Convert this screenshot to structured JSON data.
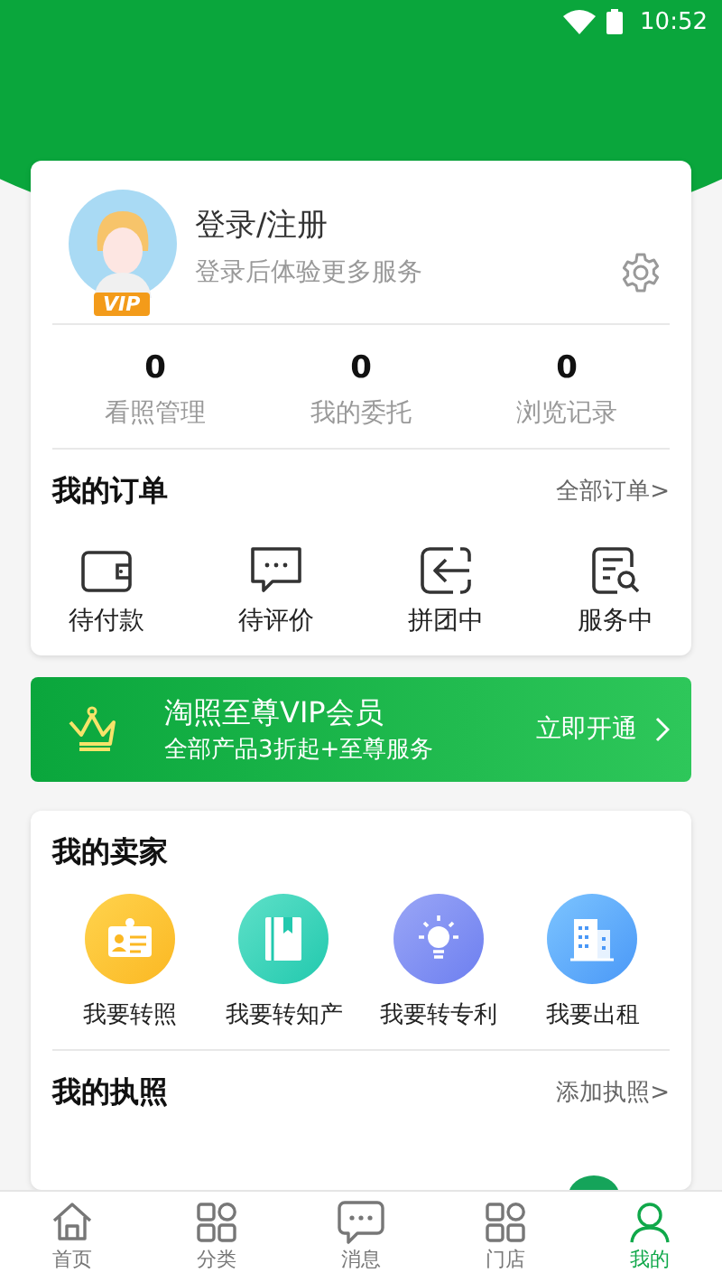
{
  "status_bar": {
    "time": "10:52"
  },
  "profile": {
    "title": "登录/注册",
    "subtitle": "登录后体验更多服务",
    "badge": "VIP"
  },
  "stats": [
    {
      "value": "0",
      "label": "看照管理"
    },
    {
      "value": "0",
      "label": "我的委托"
    },
    {
      "value": "0",
      "label": "浏览记录"
    }
  ],
  "orders": {
    "title": "我的订单",
    "link": "全部订单>",
    "items": [
      {
        "kind": "wallet",
        "label": "待付款"
      },
      {
        "kind": "comment",
        "label": "待评价"
      },
      {
        "kind": "group",
        "label": "拼团中"
      },
      {
        "kind": "service",
        "label": "服务中"
      }
    ]
  },
  "vip_banner": {
    "title": "淘照至尊VIP会员",
    "subtitle": "全部产品3折起+至尊服务",
    "action": "立即开通"
  },
  "seller": {
    "title": "我的卖家",
    "items": [
      {
        "kind": "license",
        "label": "我要转照"
      },
      {
        "kind": "book",
        "label": "我要转知产"
      },
      {
        "kind": "bulb",
        "label": "我要转专利"
      },
      {
        "kind": "building",
        "label": "我要出租"
      }
    ]
  },
  "licenses": {
    "title": "我的执照",
    "link": "添加执照>"
  },
  "tab_bar": [
    {
      "kind": "home",
      "label": "首页",
      "selected": false
    },
    {
      "kind": "grid",
      "label": "分类",
      "selected": false
    },
    {
      "kind": "chat",
      "label": "消息",
      "selected": false
    },
    {
      "kind": "grid",
      "label": "门店",
      "selected": false
    },
    {
      "kind": "person",
      "label": "我的",
      "selected": true
    }
  ]
}
